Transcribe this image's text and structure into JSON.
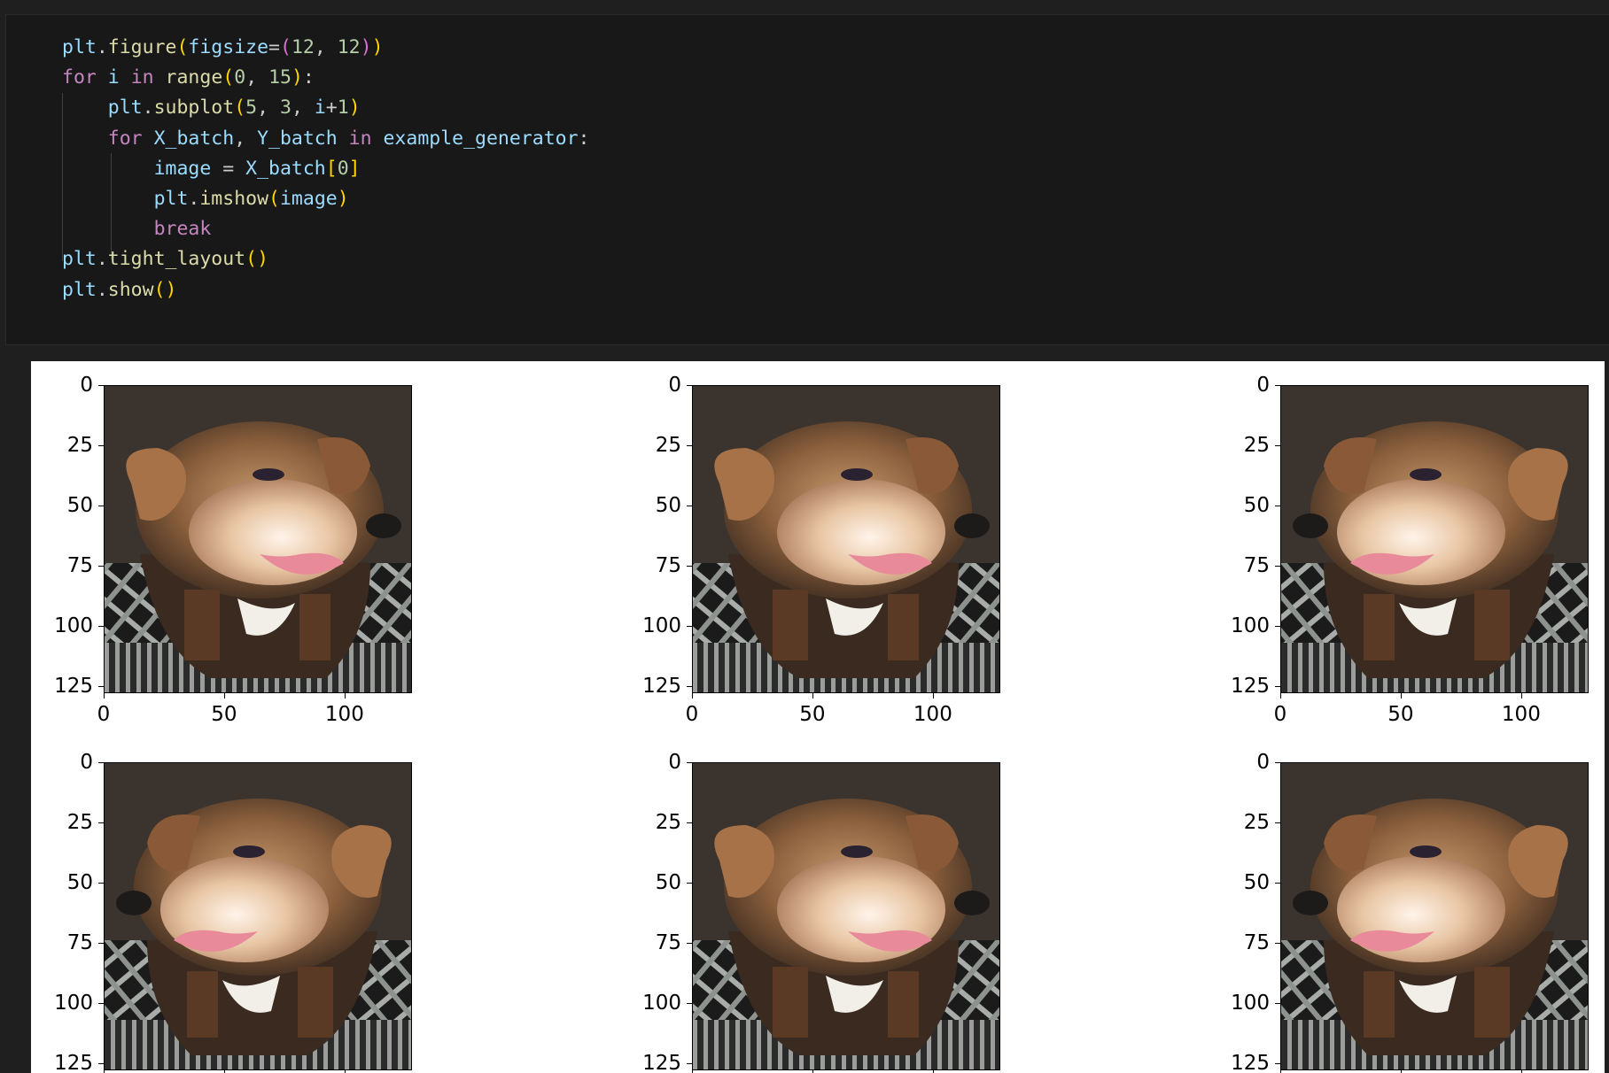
{
  "code_cell": {
    "lines": [
      "plt.figure(figsize=(12, 12))",
      "for i in range(0, 15):",
      "    plt.subplot(5, 3, i+1)",
      "    for X_batch, Y_batch in example_generator:",
      "        image = X_batch[0]",
      "        plt.imshow(image)",
      "        break",
      "plt.tight_layout()",
      "plt.show()"
    ]
  },
  "output": {
    "subplots": [
      {
        "row": 1,
        "col": 1,
        "image": "dog-augmented",
        "flip": false
      },
      {
        "row": 1,
        "col": 2,
        "image": "dog-augmented",
        "flip": false
      },
      {
        "row": 1,
        "col": 3,
        "image": "dog-augmented",
        "flip": true
      },
      {
        "row": 2,
        "col": 1,
        "image": "dog-augmented",
        "flip": true
      },
      {
        "row": 2,
        "col": 2,
        "image": "dog-augmented",
        "flip": false
      },
      {
        "row": 2,
        "col": 3,
        "image": "dog-augmented",
        "flip": true
      }
    ],
    "y_ticks": [
      "0",
      "25",
      "50",
      "75",
      "100",
      "125"
    ],
    "x_ticks": [
      "0",
      "50",
      "100"
    ]
  },
  "colors": {
    "editor_bg": "#181818",
    "page_bg": "#1f1f1f",
    "keyword": "#c586c0",
    "variable": "#9cdcfe",
    "function": "#dcdcaa",
    "number": "#b5cea8"
  }
}
